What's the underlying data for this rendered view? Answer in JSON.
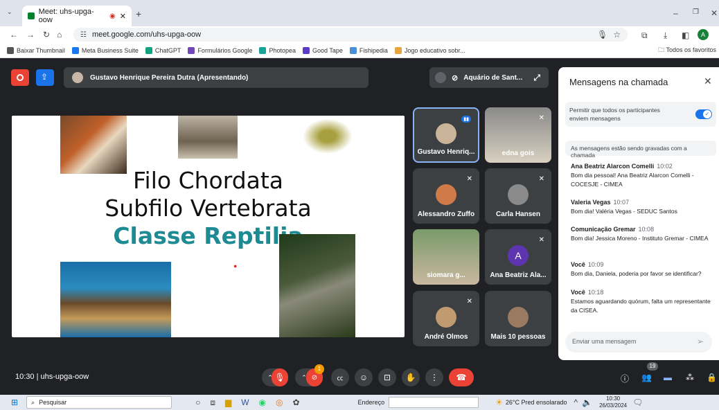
{
  "browser": {
    "tab_title": "Meet: uhs-upga-oow",
    "url": "meet.google.com/uhs-upga-oow",
    "profile_initial": "A",
    "bookmarks": [
      {
        "label": "Baixar Thumbnail",
        "color": "#555"
      },
      {
        "label": "Meta Business Suite",
        "color": "#1877f2"
      },
      {
        "label": "ChatGPT",
        "color": "#10a37f"
      },
      {
        "label": "Formulários Google",
        "color": "#7248b9"
      },
      {
        "label": "Photopea",
        "color": "#18a497"
      },
      {
        "label": "Good Tape",
        "color": "#5b3cc4"
      },
      {
        "label": "Fishipedia",
        "color": "#4a90d9"
      },
      {
        "label": "Jogo educativo sobr...",
        "color": "#e8a33d"
      }
    ],
    "all_favorites": "Todos os favoritos"
  },
  "meet": {
    "presenter": "Gustavo Henrique Pereira Dutra (Apresentando)",
    "pinned_label": "Aquário de Sant...",
    "slide": {
      "line1": "Filo Chordata",
      "line2": "Subfilo Vertebrata",
      "line3": "Classe Reptilia",
      "accent": "#1d8a94"
    },
    "tiles": [
      {
        "name": "Gustavo Henriq...",
        "active": true
      },
      {
        "name": "edna gois"
      },
      {
        "name": "Alessandro Zuffo"
      },
      {
        "name": "Carla Hansen"
      },
      {
        "name": "siomara g..."
      },
      {
        "name": "Ana Beatriz Ala...",
        "initial": "A"
      },
      {
        "name": "André Olmos"
      },
      {
        "name": "Mais 10 pessoas"
      }
    ],
    "time": "10:30",
    "code": "uhs-upga-oow",
    "people_count": "19",
    "notif": "1"
  },
  "chat": {
    "title": "Mensagens na chamada",
    "toggle_label": "Permitir que todos os participantes enviem mensagens",
    "recording_notice": "As mensagens estão sendo gravadas com a chamada",
    "messages": [
      {
        "name": "Ana Beatriz Alarcon Comelli",
        "time": "10:02",
        "text": "Bom dia pessoal! Ana Beatriz Alarcon Comelli - COCESJE - CIMEA"
      },
      {
        "name": "Valeria Vegas",
        "time": "10:07",
        "text": "Bom dia! Valéria Vegas - SEDUC Santos"
      },
      {
        "name": "Comunicação Gremar",
        "time": "10:08",
        "text": "Bom dia! Jessica Moreno - Instituto Gremar - CIMEA"
      },
      {
        "name": "Você",
        "time": "10:09",
        "text": "Bom dia, Daniela, poderia por favor se identificar?"
      },
      {
        "name": "Você",
        "time": "10:18",
        "text": "Estamos aguardando quórum, falta um representante da CISEA."
      }
    ],
    "input_placeholder": "Enviar uma mensagem"
  },
  "taskbar": {
    "search": "Pesquisar",
    "address_label": "Endereço",
    "weather": "26°C  Pred ensolarado",
    "clock_time": "10:30",
    "clock_date": "26/03/2024"
  }
}
